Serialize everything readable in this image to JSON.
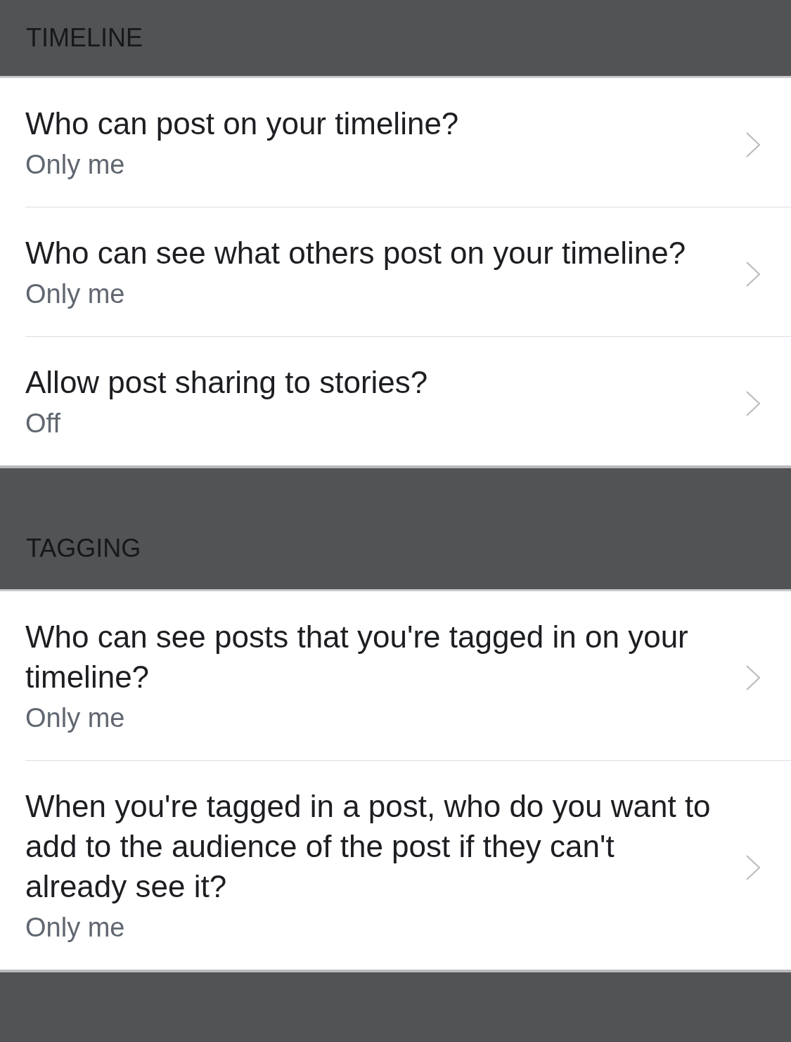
{
  "sections": [
    {
      "title": "TIMELINE",
      "items": [
        {
          "label": "Who can post on your timeline?",
          "value": "Only me"
        },
        {
          "label": "Who can see what others post on your timeline?",
          "value": "Only me"
        },
        {
          "label": "Allow post sharing to stories?",
          "value": "Off"
        }
      ]
    },
    {
      "title": "TAGGING",
      "items": [
        {
          "label": "Who can see posts that you're tagged in on your timeline?",
          "value": "Only me"
        },
        {
          "label": "When you're tagged in a post, who do you want to add to the audience of the post if they can't already see it?",
          "value": "Only me"
        }
      ]
    }
  ]
}
